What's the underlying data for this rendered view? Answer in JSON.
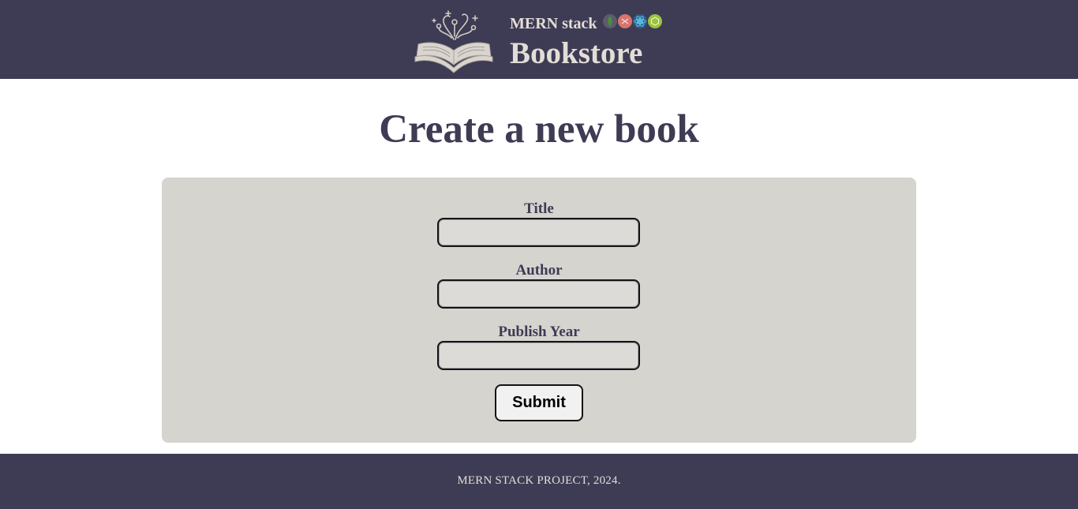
{
  "header": {
    "subtitle": "MERN stack",
    "title": "Bookstore",
    "logo_icon": "open-book-icon",
    "tech_icons": [
      {
        "name": "mongodb-icon",
        "color": "#4a8f3c"
      },
      {
        "name": "express-icon",
        "color": "#d9736e"
      },
      {
        "name": "react-icon",
        "color": "#3aa0e0"
      },
      {
        "name": "nodejs-icon",
        "color": "#9cc23e"
      }
    ]
  },
  "page": {
    "title": "Create a new book"
  },
  "form": {
    "fields": [
      {
        "label": "Title",
        "value": "",
        "placeholder": ""
      },
      {
        "label": "Author",
        "value": "",
        "placeholder": ""
      },
      {
        "label": "Publish Year",
        "value": "",
        "placeholder": ""
      }
    ],
    "submit_label": "Submit"
  },
  "footer": {
    "text": "MERN STACK PROJECT, 2024."
  },
  "colors": {
    "header_bg": "#3e3b54",
    "card_bg": "#d5d4cf",
    "text_light": "#e2ddd6",
    "text_dark": "#3e3b54"
  }
}
